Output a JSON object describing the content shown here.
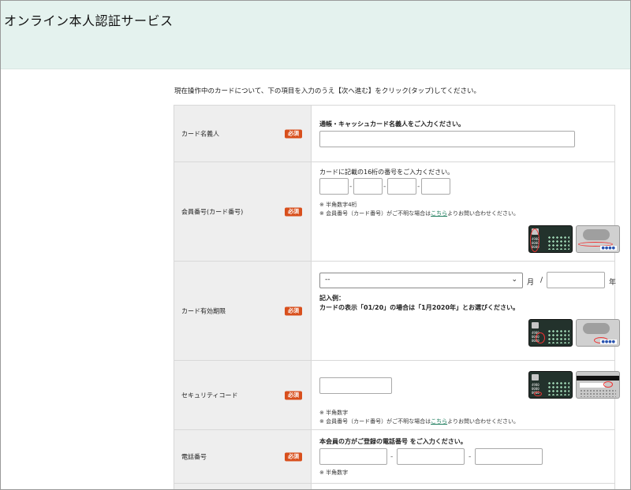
{
  "site": {
    "title": "オンライン本人認証サービス"
  },
  "intro": "現在操作中のカードについて、下の項目を入力のうえ【次へ進む】をクリック(タップ)してください。",
  "required_badge": "必須",
  "rows": {
    "holder": {
      "label": "カード名義人",
      "instruction": "通帳・キャッシュカード名義人をご入力ください。",
      "value": ""
    },
    "card_number": {
      "label": "会員番号(カード番号)",
      "instruction": "カードに記載の16桁の番号をご入力ください。",
      "segments": [
        "",
        "",
        "",
        ""
      ],
      "separator": "-",
      "note1": "※ 半角数字4桁",
      "note2_before": "※ 会員番号（カード番号）がご不明な場合は",
      "note2_link": "こちら",
      "note2_after": "よりお問い合わせください。"
    },
    "expiry": {
      "label": "カード有効期限",
      "month_selected": "--",
      "month_unit": "月",
      "slash": "/",
      "year_value": "",
      "year_unit": "年",
      "example_title": "記入例：",
      "example_text": "カードの表示「01/20」の場合は「1月2020年」とお選びください。"
    },
    "security": {
      "label": "セキュリティコード",
      "value": "",
      "note1": "※ 半角数字",
      "note2_before": "※ 会員番号（カード番号）がご不明な場合は",
      "note2_link": "こちら",
      "note2_after": "よりお問い合わせください。"
    },
    "phone": {
      "label": "電話番号",
      "instruction": "本会員の方がご登録の電話番号 をご入力ください。",
      "segments": [
        "",
        "",
        ""
      ],
      "separator": "-",
      "note1": "※ 半角数字"
    }
  },
  "card_art": {
    "front_number_lines": [
      "4980",
      "0000",
      "0000",
      "0000"
    ],
    "back_dots": "●●●●"
  }
}
